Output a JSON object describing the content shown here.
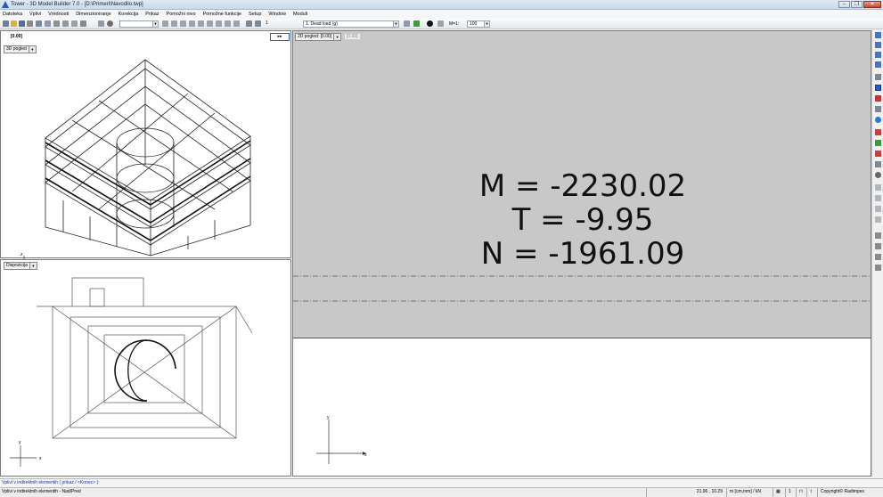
{
  "window": {
    "title": "Tower - 3D Model Builder 7.0 - [D:\\Primeri\\Navodilo.twp]"
  },
  "menu": [
    "Datoteka",
    "Vplivi",
    "Vrednosti",
    "Dimenzioniranje",
    "Korekcija",
    "Prikaz",
    "Pomožni nivo",
    "Pomožne funkcije",
    "Setup",
    "Window",
    "Moduli"
  ],
  "toolbar": {
    "load_case": "1. Dead load (g)",
    "step_label": "M=1:",
    "step_value": "100",
    "blank_combo": "",
    "counter": "1"
  },
  "left_top": {
    "coord_readout": "[0.00]",
    "view_select": "3D pogled"
  },
  "left_bottom": {
    "view_select": "Dispozicija"
  },
  "right_view": {
    "view_select": "2D pogled: [0.00]",
    "extra_value": "[0.00]"
  },
  "forces": {
    "moment": "M = -2230.02",
    "shear": "T = -9.95",
    "axial": "N = -1961.09"
  },
  "axes": {
    "x": "x",
    "y": "y",
    "z": "z"
  },
  "command_line": "Vplivi v indirektnih elementih ( prikaz / <Konec> ):",
  "status": {
    "left": "Vplivi v indirektnih elementih - Nad/Pred",
    "coords": "21.96 , 10.29",
    "units": "m [cm,mm] / kN",
    "page": "1",
    "copyright": "Copyright© Radimpex"
  },
  "colors": {
    "gray_view": "#c8c8c8",
    "accent_blue": "#1e5fc8"
  }
}
